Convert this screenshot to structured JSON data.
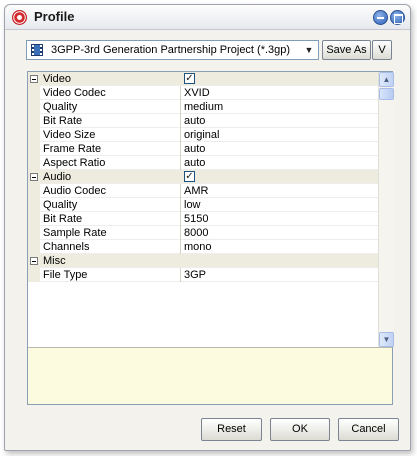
{
  "window": {
    "title": "Profile"
  },
  "toolbar": {
    "profile_value": "3GPP-3rd Generation Partnership Project (*.3gp)",
    "save_as_label": "Save As",
    "v_label": "V"
  },
  "properties": [
    {
      "type": "category",
      "name": "Video",
      "checked": true
    },
    {
      "type": "item",
      "name": "Video Codec",
      "value": "XVID"
    },
    {
      "type": "item",
      "name": "Quality",
      "value": "medium"
    },
    {
      "type": "item",
      "name": "Bit Rate",
      "value": "auto"
    },
    {
      "type": "item",
      "name": "Video Size",
      "value": "original"
    },
    {
      "type": "item",
      "name": "Frame Rate",
      "value": "auto"
    },
    {
      "type": "item",
      "name": "Aspect Ratio",
      "value": "auto"
    },
    {
      "type": "category",
      "name": "Audio",
      "checked": true
    },
    {
      "type": "item",
      "name": "Audio Codec",
      "value": "AMR"
    },
    {
      "type": "item",
      "name": "Quality",
      "value": "low"
    },
    {
      "type": "item",
      "name": "Bit Rate",
      "value": "5150"
    },
    {
      "type": "item",
      "name": "Sample Rate",
      "value": "8000"
    },
    {
      "type": "item",
      "name": "Channels",
      "value": "mono"
    },
    {
      "type": "category",
      "name": "Misc"
    },
    {
      "type": "item",
      "name": "File Type",
      "value": "3GP"
    }
  ],
  "icons": {
    "app": "app-logo-icon",
    "profile": "film-icon",
    "dropdown": "chevron-down-icon",
    "minimize": "minimize-icon",
    "maximize": "maximize-icon",
    "expander": "collapse-icon",
    "check": "checkmark-icon"
  },
  "checkmark_glyph": "✓",
  "scroll_up_glyph": "▲",
  "scroll_down_glyph": "▼",
  "dropdown_glyph": "▼",
  "buttons": {
    "reset_label": "Reset",
    "ok_label": "OK",
    "cancel_label": "Cancel"
  },
  "colors": {
    "category_bg": "#eeecdf",
    "description_bg": "#fcfbe0",
    "accent": "#2c5fb8"
  }
}
